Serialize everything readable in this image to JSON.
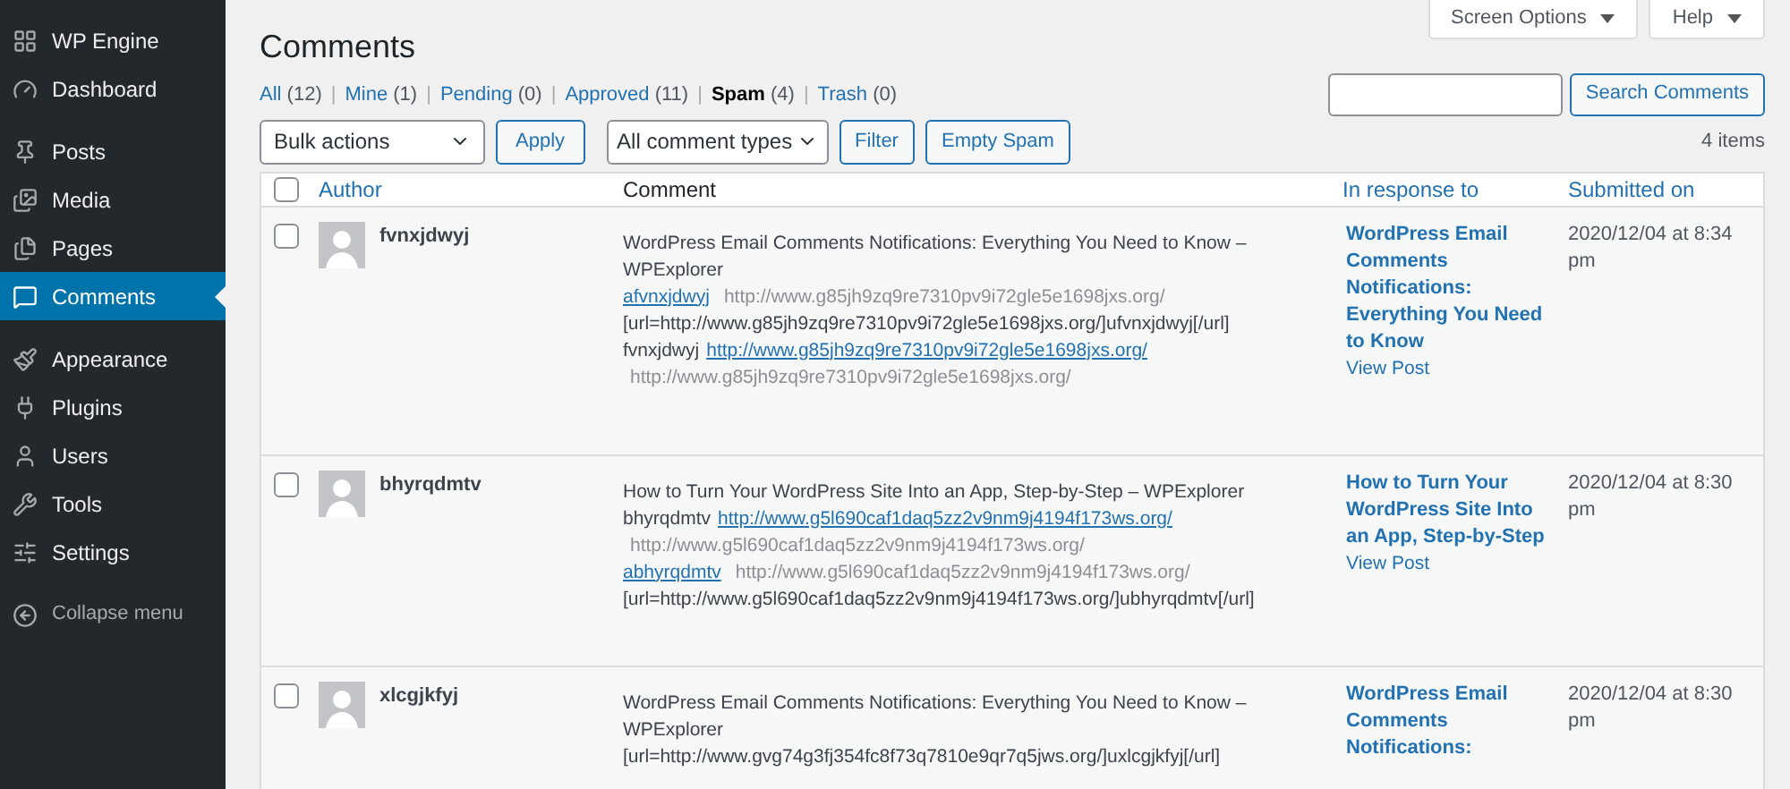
{
  "sidebar": {
    "groups": [
      [
        {
          "label": "WP Engine",
          "selected": false
        },
        {
          "label": "Dashboard",
          "selected": false
        }
      ],
      [
        {
          "label": "Posts",
          "selected": false
        },
        {
          "label": "Media",
          "selected": false
        },
        {
          "label": "Pages",
          "selected": false
        },
        {
          "label": "Comments",
          "selected": true
        }
      ],
      [
        {
          "label": "Appearance",
          "selected": false
        },
        {
          "label": "Plugins",
          "selected": false
        },
        {
          "label": "Users",
          "selected": false
        },
        {
          "label": "Tools",
          "selected": false
        },
        {
          "label": "Settings",
          "selected": false
        }
      ]
    ],
    "collapse": "Collapse menu"
  },
  "top_buttons": [
    "Screen Options",
    "Help"
  ],
  "title": "Comments",
  "filters": [
    {
      "label": "All",
      "count": "(12)",
      "selected": false,
      "separator": "|"
    },
    {
      "label": "Mine",
      "count": "(1)",
      "selected": false,
      "separator": "|"
    },
    {
      "label": "Pending",
      "count": "(0)",
      "selected": false,
      "separator": "|"
    },
    {
      "label": "Approved",
      "count": "(11)",
      "selected": false,
      "separator": "|"
    },
    {
      "label": "Spam",
      "count": "(4)",
      "selected": true,
      "separator": "|"
    },
    {
      "label": "Trash",
      "count": "(0)",
      "selected": false
    }
  ],
  "search": {
    "button": "Search Comments"
  },
  "toolbar": {
    "bulk_actions": "Bulk actions",
    "apply": "Apply",
    "comment_types": "All comment types",
    "filter": "Filter",
    "empty_spam": "Empty Spam",
    "count": "4 items"
  },
  "table": {
    "select_all": false,
    "columns": [
      {
        "label": "Author",
        "sortable": true
      },
      {
        "label": "Comment",
        "sortable": false
      },
      {
        "label": "In response to",
        "sortable": true
      },
      {
        "label": "Submitted on",
        "sortable": true
      }
    ],
    "rows": [
      {
        "checked": false,
        "author": "fvnxjdwyj",
        "lines": [
          [
            {
              "kind": "text",
              "text": "WordPress Email Comments Notifications: Everything You Need to Know –"
            }
          ],
          [
            {
              "kind": "text",
              "text": "WPExplorer"
            }
          ],
          [
            {
              "kind": "link",
              "text": "afvnxjdwyj"
            },
            {
              "kind": "url",
              "text": "http://www.g85jh9zq9re7310pv9i72gle5e1698jxs.org/"
            }
          ],
          [
            {
              "kind": "text",
              "text": "[url=http://www.g85jh9zq9re7310pv9i72gle5e1698jxs.org/]ufvnxjdwyj[/url]"
            }
          ],
          [
            {
              "kind": "text",
              "text": "fvnxjdwyj"
            },
            {
              "kind": "link",
              "text": "http://www.g85jh9zq9re7310pv9i72gle5e1698jxs.org/"
            }
          ],
          [
            {
              "kind": "url",
              "text": "http://www.g85jh9zq9re7310pv9i72gle5e1698jxs.org/"
            }
          ]
        ],
        "response": "WordPress Email Comments Notifications: Everything You Need to Know",
        "view": "View Post",
        "submitted": "2020/12/04 at 8:34 pm"
      },
      {
        "checked": false,
        "author": "bhyrqdmtv",
        "lines": [
          [
            {
              "kind": "text",
              "text": "How to Turn Your WordPress Site Into an App, Step-by-Step – WPExplorer"
            }
          ],
          [
            {
              "kind": "text",
              "text": "bhyrqdmtv"
            },
            {
              "kind": "link",
              "text": "http://www.g5l690caf1daq5zz2v9nm9j4194f173ws.org/"
            }
          ],
          [
            {
              "kind": "url",
              "text": "http://www.g5l690caf1daq5zz2v9nm9j4194f173ws.org/"
            }
          ],
          [
            {
              "kind": "link",
              "text": "abhyrqdmtv"
            },
            {
              "kind": "url",
              "text": "http://www.g5l690caf1daq5zz2v9nm9j4194f173ws.org/"
            }
          ],
          [
            {
              "kind": "text",
              "text": "[url=http://www.g5l690caf1daq5zz2v9nm9j4194f173ws.org/]ubhyrqdmtv[/url]"
            }
          ]
        ],
        "response": "How to Turn Your WordPress Site Into an App, Step-by-Step",
        "view": "View Post",
        "submitted": "2020/12/04 at 8:30 pm"
      },
      {
        "checked": false,
        "author": "xlcgjkfyj",
        "lines": [
          [
            {
              "kind": "text",
              "text": "WordPress Email Comments Notifications: Everything You Need to Know –"
            }
          ],
          [
            {
              "kind": "text",
              "text": "WPExplorer"
            }
          ],
          [
            {
              "kind": "text",
              "text": "[url=http://www.gvg74g3fj354fc8f73q7810e9qr7q5jws.org/]uxlcgjkfyj[/url]"
            }
          ]
        ],
        "response": "WordPress Email Comments Notifications:",
        "submitted": "2020/12/04 at 8:30 pm"
      }
    ]
  }
}
